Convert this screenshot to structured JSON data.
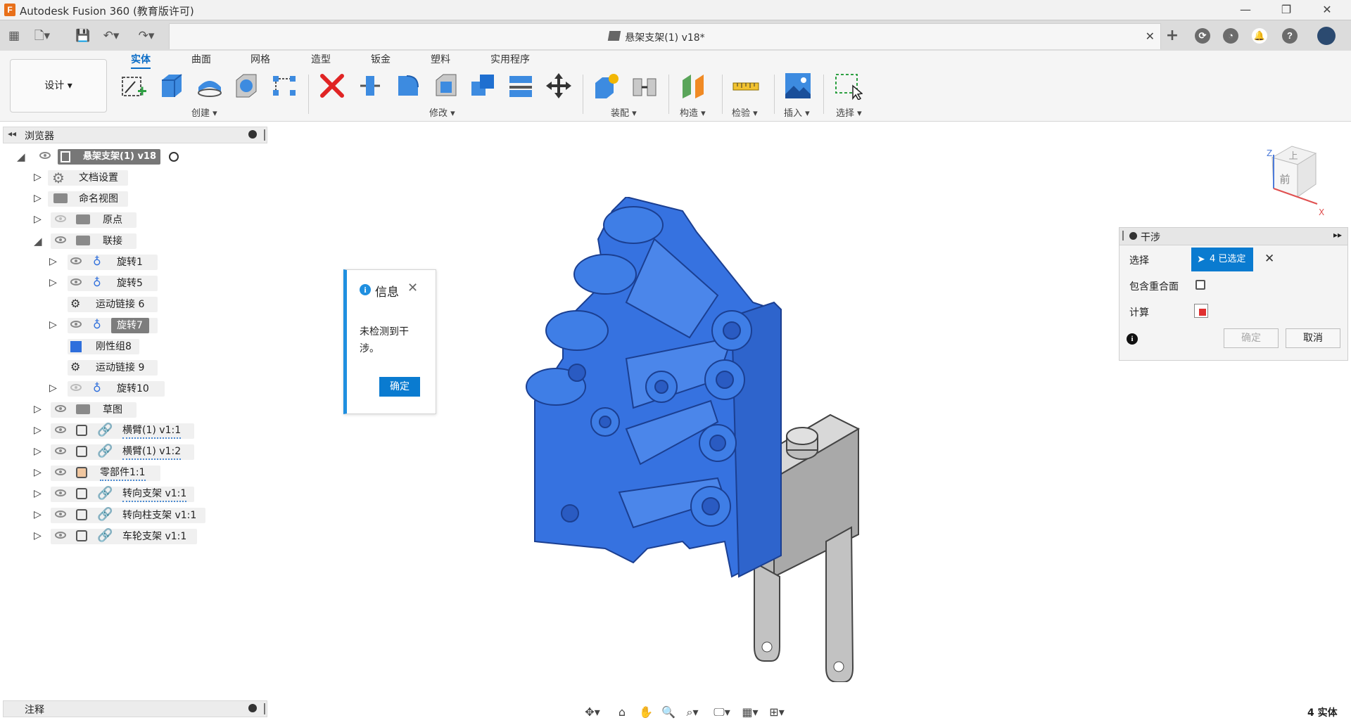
{
  "app": {
    "title": "Autodesk Fusion 360 (教育版许可)",
    "icon_letter": "F"
  },
  "document": {
    "tab_title": "悬架支架(1) v18*"
  },
  "toolbar": {
    "workspace": "设计 ▾",
    "tabs": [
      "实体",
      "曲面",
      "网格",
      "造型",
      "钣金",
      "塑料",
      "实用程序"
    ],
    "groups": {
      "create": "创建 ▾",
      "modify": "修改 ▾",
      "assemble": "装配 ▾",
      "construct": "构造 ▾",
      "inspect": "检验 ▾",
      "insert": "插入 ▾",
      "select": "选择 ▾"
    }
  },
  "browser": {
    "title": "浏览器",
    "root": "悬架支架(1) v18",
    "items": {
      "doc_settings": "文档设置",
      "named_views": "命名视图",
      "origin": "原点",
      "joints": "联接",
      "rev1": "旋转1",
      "rev5": "旋转5",
      "motion6": "运动链接 6",
      "rev7": "旋转7",
      "rigid8": "刚性组8",
      "motion9": "运动链接 9",
      "rev10": "旋转10",
      "sketches": "草图",
      "c1": "横臂(1) v1:1",
      "c2": "横臂(1) v1:2",
      "c3": "零部件1:1",
      "c4": "转向支架 v1:1",
      "c5": "转向柱支架 v1:1",
      "c6": "车轮支架 v1:1"
    }
  },
  "notes": {
    "title": "注释"
  },
  "info_popup": {
    "title": "信息",
    "message": "未检测到干涉。",
    "ok": "确定"
  },
  "interference": {
    "title": "干涉",
    "select_label": "选择",
    "selected": "4 已选定",
    "include_coincident_label": "包含重合面",
    "compute_label": "计算",
    "ok": "确定",
    "cancel": "取消"
  },
  "viewcube": {
    "top": "上",
    "front": "前",
    "x_axis": "X",
    "z_axis": "Z"
  },
  "status": {
    "bodies": "4 实体"
  },
  "colors": {
    "accent": "#0a6cc6",
    "selection_blue": "#2f6fdc",
    "popup_bar": "#1f8fe0"
  }
}
